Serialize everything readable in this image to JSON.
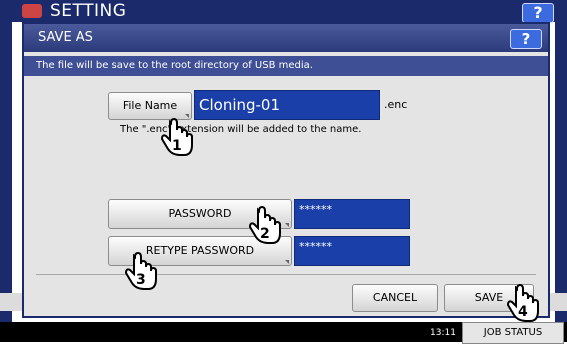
{
  "background": {
    "title": "SETTING",
    "help_label": "?",
    "time": "13:11",
    "job_status": "JOB STATUS"
  },
  "dialog": {
    "title": "SAVE AS",
    "help_label": "?",
    "info": "The file will be save to the root directory of USB media.",
    "file_name_button": "File Name",
    "file_name_value": "Cloning-01",
    "extension": ".enc",
    "note": "The \".enc\" extension will be added to the name.",
    "password_button": "PASSWORD",
    "password_value": "******",
    "retype_button": "RETYPE PASSWORD",
    "retype_value": "******",
    "cancel_button": "CANCEL",
    "save_button": "SAVE"
  },
  "callouts": [
    "1",
    "2",
    "3",
    "4"
  ]
}
